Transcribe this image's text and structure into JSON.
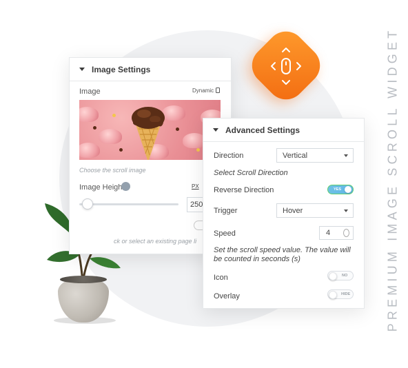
{
  "vertical_title": "PREMIUM IMAGE SCROLL WIDGET",
  "colors": {
    "accent_orange": "#f26a10",
    "toggle_on": "#6ec1e4",
    "bg_circle": "#f1f2f4"
  },
  "badge": {
    "icon": "scroll-direction-icon"
  },
  "image_settings": {
    "header": "Image Settings",
    "image_label": "Image",
    "dynamic_label": "Dynamic",
    "dynamic_icon": "database-icon",
    "image_help": "Choose the scroll image",
    "height_label": "Image Height",
    "height_unit": "PX",
    "height_value": "250",
    "height_slider_fraction": 0.05,
    "link_help_visible": "ck or select an existing page li"
  },
  "advanced_settings": {
    "header": "Advanced Settings",
    "direction_label": "Direction",
    "direction_value": "Vertical",
    "direction_help": "Select Scroll Direction",
    "reverse_label": "Reverse Direction",
    "reverse_toggle": "YES",
    "trigger_label": "Trigger",
    "trigger_value": "Hover",
    "speed_label": "Speed",
    "speed_value": "4",
    "speed_help": "Set the scroll speed value. The value will be counted in seconds (s)",
    "icon_label": "Icon",
    "icon_toggle": "NO",
    "overlay_label": "Overlay",
    "overlay_toggle": "HIDE"
  }
}
